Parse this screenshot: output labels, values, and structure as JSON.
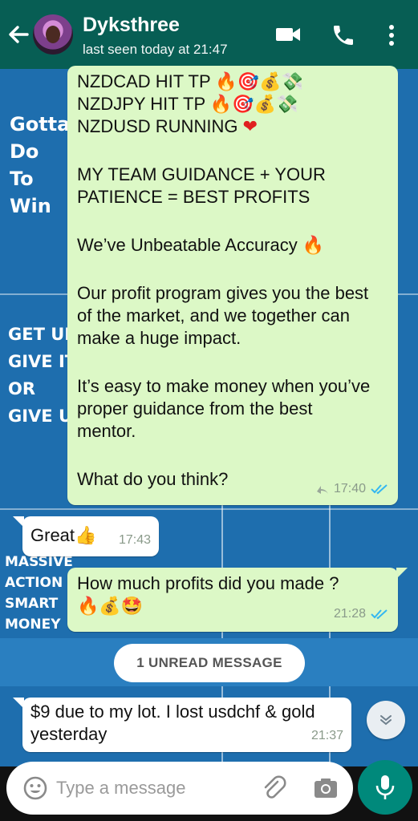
{
  "header": {
    "contact_name": "Dyksthree",
    "status": "last seen today at 21:47",
    "bg_color": "#075e54"
  },
  "wallpaper": {
    "text_block_1": [
      "Gotta",
      "Do",
      "To",
      "Win"
    ],
    "text_block_2": [
      "GET UP",
      "GIVE IT",
      "OR",
      "GIVE UP"
    ],
    "text_block_3": [
      "MASSIVE",
      "ACTION",
      "SMART",
      "MONEY"
    ]
  },
  "messages": [
    {
      "direction": "outgoing",
      "lines": [
        "NZDCAD HIT TP",
        "NZDJPY HIT TP",
        "NZDUSD RUNNING",
        "",
        "MY TEAM GUIDANCE + YOUR",
        "PATIENCE = BEST PROFITS",
        "",
        "We’ve Unbeatable Accuracy",
        "",
        "Our profit program gives you the best",
        "of the market, and we together can",
        "make a huge impact.",
        "",
        "It’s easy to make money when you’ve",
        "proper guidance from the best",
        "mentor.",
        "",
        "What do you think?"
      ],
      "time": "17:40",
      "status": "read"
    },
    {
      "direction": "incoming",
      "text": "Great",
      "time": "17:43"
    },
    {
      "direction": "outgoing",
      "text": "How much profits did you made ?",
      "time": "21:28",
      "status": "read"
    },
    {
      "direction": "incoming",
      "lines": [
        "$9 due to my lot. I lost usdchf & gold",
        "yesterday"
      ],
      "time": "21:37"
    }
  ],
  "unread_banner": "1 UNREAD MESSAGE",
  "composer": {
    "placeholder": "Type a message"
  },
  "colors": {
    "outgoing_bubble": "#dcf8c6",
    "incoming_bubble": "#ffffff",
    "read_ticks": "#34b7f1",
    "fab": "#00897b"
  },
  "icons": [
    "back-arrow-icon",
    "video-call-icon",
    "phone-icon",
    "more-options-icon",
    "forwarded-icon",
    "double-check-icon",
    "chevron-down-icon",
    "emoji-icon",
    "attachment-icon",
    "camera-icon",
    "microphone-icon"
  ]
}
